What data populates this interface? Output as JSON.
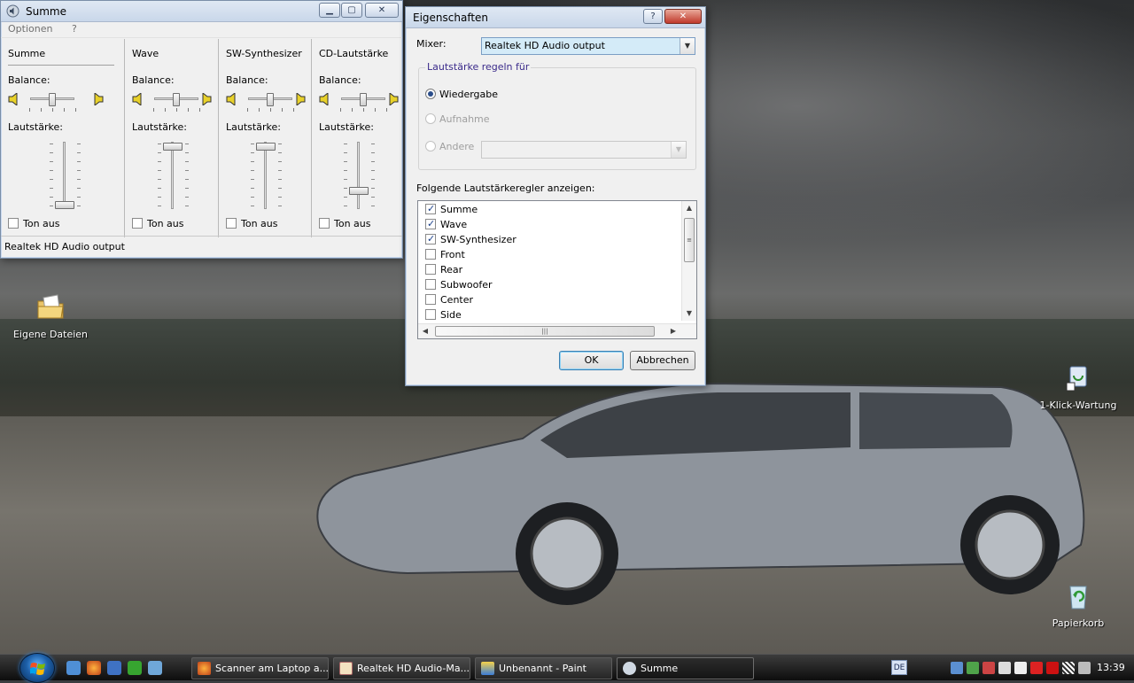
{
  "mixer_window": {
    "title": "Summe",
    "menu": [
      "Optionen",
      "?"
    ],
    "balance_label": "Balance:",
    "volume_label": "Lautstärke:",
    "mute_label": "Ton aus",
    "channels": [
      {
        "name": "Summe",
        "volume_level": 0.0,
        "muted": false
      },
      {
        "name": "Wave",
        "volume_level": 1.0,
        "muted": false
      },
      {
        "name": "SW-Synthesizer",
        "volume_level": 1.0,
        "muted": false
      },
      {
        "name": "CD-Lautstärke",
        "volume_level": 0.25,
        "muted": false
      }
    ],
    "status": "Realtek HD Audio output"
  },
  "properties_dialog": {
    "title": "Eigenschaften",
    "help_button": "?",
    "mixer_label": "Mixer:",
    "mixer_value": "Realtek HD Audio output",
    "group_title": "Lautstärke regeln für",
    "radio_playback": "Wiedergabe",
    "radio_recording": "Aufnahme",
    "radio_other": "Andere",
    "list_label": "Folgende Lautstärkeregler anzeigen:",
    "list_items": [
      {
        "label": "Summe",
        "checked": true
      },
      {
        "label": "Wave",
        "checked": true
      },
      {
        "label": "SW-Synthesizer",
        "checked": true
      },
      {
        "label": "Front",
        "checked": false
      },
      {
        "label": "Rear",
        "checked": false
      },
      {
        "label": "Subwoofer",
        "checked": false
      },
      {
        "label": "Center",
        "checked": false
      },
      {
        "label": "Side",
        "checked": false
      }
    ],
    "ok_button": "OK",
    "cancel_button": "Abbrechen"
  },
  "desktop_icons": [
    {
      "label": "Eigene Dateien",
      "icon": "folder-icon"
    },
    {
      "label": "1-Klick-Wartung",
      "icon": "maintenance-icon"
    },
    {
      "label": "Papierkorb",
      "icon": "recycle-bin-icon"
    }
  ],
  "taskbar": {
    "tasks": [
      {
        "label": "Scanner am Laptop a...",
        "icon": "firefox-icon"
      },
      {
        "label": "Realtek HD Audio-Ma...",
        "icon": "speaker-icon"
      },
      {
        "label": "Unbenannt - Paint",
        "icon": "paint-icon"
      },
      {
        "label": "Summe",
        "icon": "volume-icon"
      }
    ],
    "language": "DE",
    "clock": "13:39"
  }
}
